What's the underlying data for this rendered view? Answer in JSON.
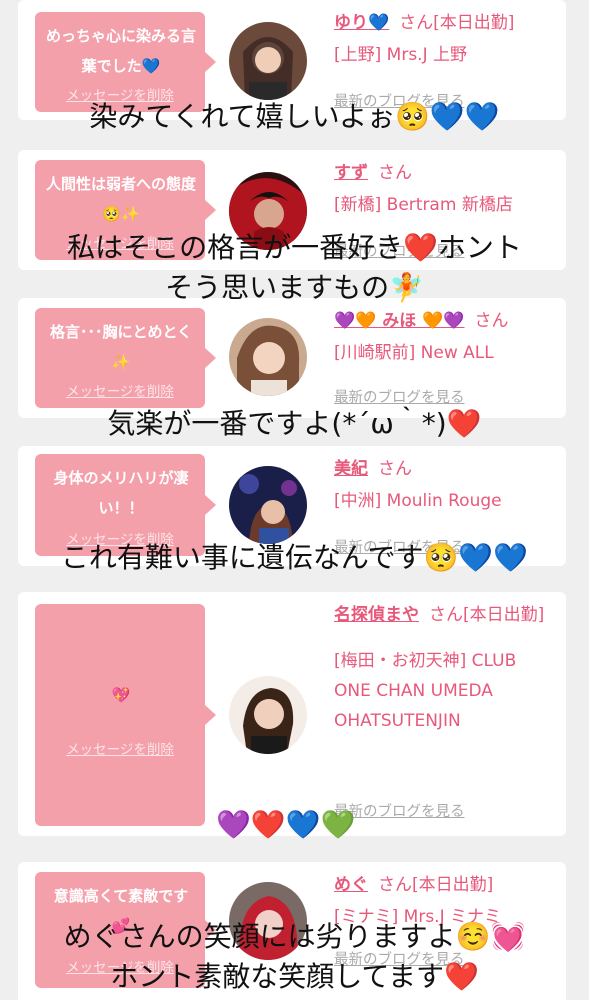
{
  "cards": [
    {
      "message": "めっちゃ心に染みる言葉でした💙",
      "delete_label": "メッセージを削除",
      "name": "ゆり💙",
      "san": "さん[本日出勤]",
      "shop": "[上野] Mrs.J 上野",
      "blog_label": "最新のブログを見る"
    },
    {
      "message": "人間性は弱者への態度🥺✨",
      "delete_label": "メッセージを削除",
      "name": "すず",
      "san": "さん",
      "shop": "[新橋] Bertram 新橋店",
      "blog_label": "最新のブログを見る"
    },
    {
      "message": "格言･･･胸にとめとく✨",
      "delete_label": "メッセージを削除",
      "name": "💜🧡 みほ 🧡💜",
      "san": "さん",
      "shop": "[川崎駅前] New ALL",
      "blog_label": "最新のブログを見る"
    },
    {
      "message": "身体のメリハリが凄い！！",
      "delete_label": "メッセージを削除",
      "name": "美紀",
      "san": "さん",
      "shop": "[中洲] Moulin Rouge",
      "blog_label": "最新のブログを見る"
    },
    {
      "message": "💖",
      "delete_label": "メッセージを削除",
      "name": "名探偵まや",
      "san": "さん[本日出勤]",
      "shop": "[梅田・お初天神] CLUB ONE CHAN UMEDA OHATSUTENJIN",
      "blog_label": "最新のブログを見る"
    },
    {
      "message": "意識高くて素敵です💕",
      "delete_label": "メッセージを削除",
      "name": "めぐ",
      "san": "さん[本日出勤]",
      "shop": "[ミナミ] Mrs.J ミナミ",
      "blog_label": "最新のブログを見る"
    }
  ],
  "overlays": [
    "染みてくれて嬉しいよぉ🥺💙💙",
    "私はそこの格言が一番好き❤️ホント",
    "そう思いますもの🧚",
    "気楽が一番ですよ(*´ω｀*)❤️",
    "これ有難い事に遺伝なんです🥺💙💙",
    "💜❤️💙💚",
    "めぐさんの笑顔には劣りますよ☺️💓",
    "ホント素敵な笑顔してます❤️"
  ],
  "colors": {
    "accent": "#e8587a",
    "bubble": "#f4a0ab",
    "background": "#efefef",
    "card": "#ffffff"
  }
}
